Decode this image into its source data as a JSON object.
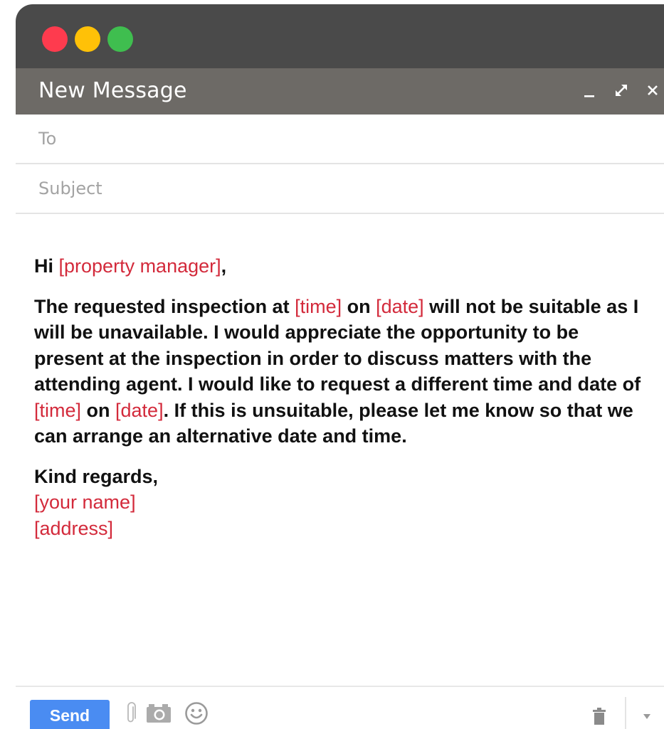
{
  "window": {
    "traffic_lights": {
      "close_color": "#fe3b4e",
      "minimize_color": "#ffc107",
      "maximize_color": "#3fbe4f"
    }
  },
  "header": {
    "title": "New Message",
    "minimize_icon": "minimize-icon",
    "expand_icon": "expand-icon",
    "close_icon": "close-icon"
  },
  "fields": {
    "to_placeholder": "To",
    "to_value": "",
    "subject_placeholder": "Subject",
    "subject_value": ""
  },
  "body": {
    "greeting_prefix": "Hi ",
    "greeting_placeholder": "[property manager]",
    "greeting_suffix": ",",
    "p1_a": "The requested inspection at ",
    "p1_time1": "[time]",
    "p1_b": " on ",
    "p1_date1": "[date]",
    "p1_c": " will not be suitable as I will be unavailable. I would appreciate the opportunity to be present at the inspection in order to discuss matters with the attending agent. I would like to request a different time and date of ",
    "p1_time2": "[time]",
    "p1_d": " on ",
    "p1_date2": "[date]",
    "p1_e": ". If this is unsuitable, please let me know so that we can arrange an alternative date and time.",
    "closing": "Kind regards,",
    "name_placeholder": "[your name]",
    "address_placeholder": "[address]"
  },
  "footer": {
    "send_label": "Send",
    "icons": [
      "paperclip-icon",
      "camera-icon",
      "emoji-icon",
      "trash-icon",
      "more-options-icon"
    ]
  },
  "colors": {
    "placeholder_text": "#d32a3b",
    "send_button": "#4a8cf2",
    "header_bar": "#6d6a66",
    "title_bar": "#4a4a4a"
  }
}
